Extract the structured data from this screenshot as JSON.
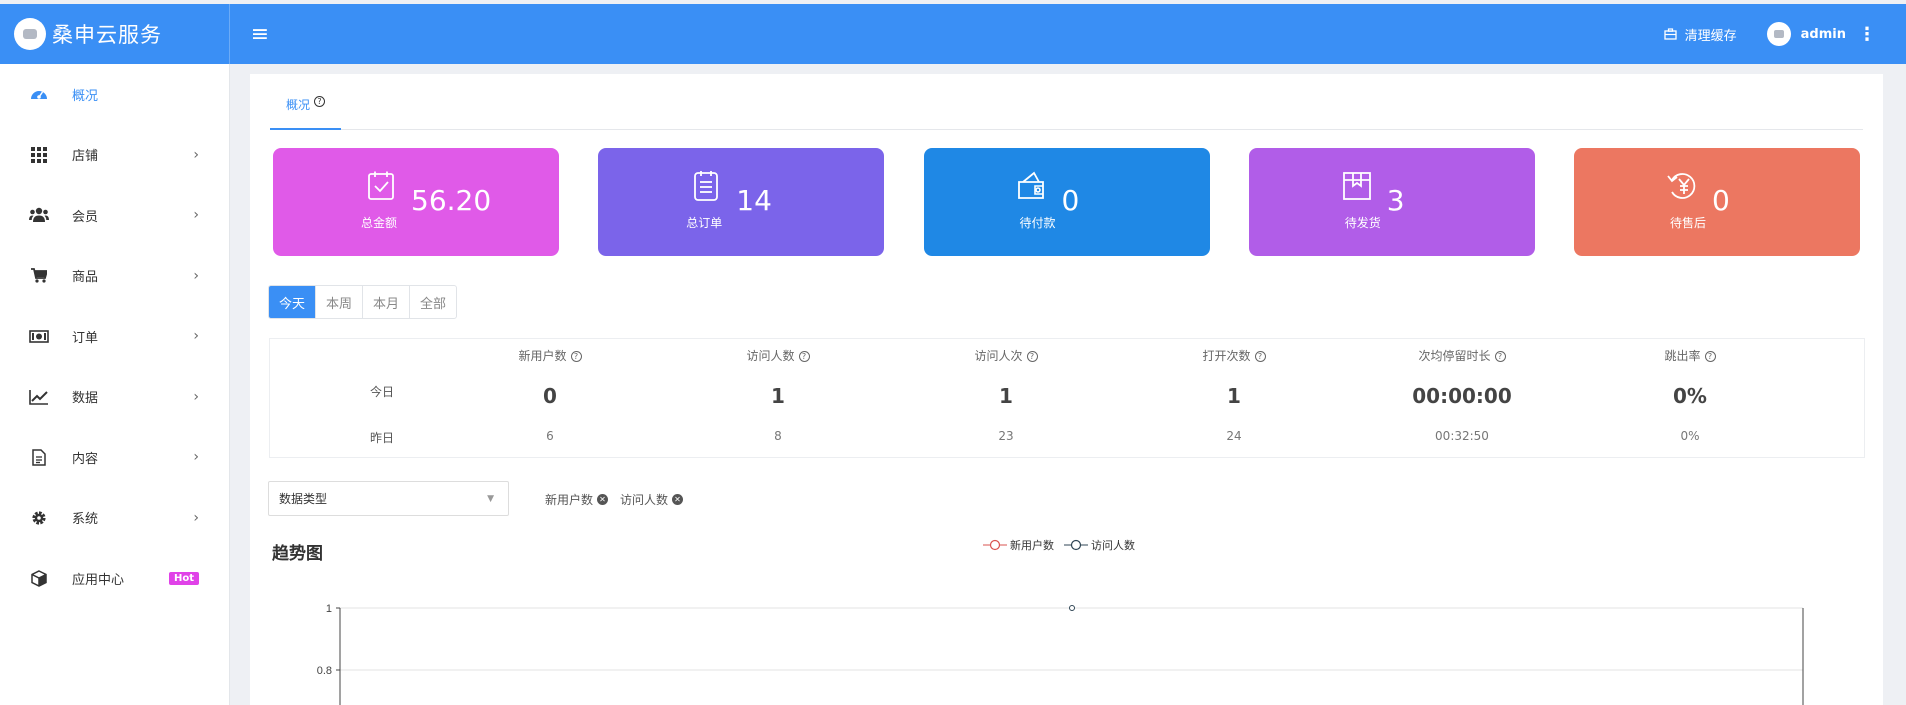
{
  "brand": {
    "name": "桑申云服务"
  },
  "header": {
    "clear_cache": "清理缓存",
    "user": "admin"
  },
  "sidebar": {
    "items": [
      {
        "label": "概况",
        "icon": "dashboard-icon"
      },
      {
        "label": "店铺",
        "icon": "grid-icon"
      },
      {
        "label": "会员",
        "icon": "users-icon"
      },
      {
        "label": "商品",
        "icon": "cart-icon"
      },
      {
        "label": "订单",
        "icon": "money-icon"
      },
      {
        "label": "数据",
        "icon": "line-chart-icon"
      },
      {
        "label": "内容",
        "icon": "document-icon"
      },
      {
        "label": "系统",
        "icon": "gear-icon"
      },
      {
        "label": "应用中心",
        "icon": "cube-icon",
        "badge": "Hot"
      }
    ]
  },
  "tabs": {
    "overview": "概况"
  },
  "cards": [
    {
      "value": "56.20",
      "label": "总金额",
      "color": "#e05ae8",
      "icon": "check-clipboard-icon"
    },
    {
      "value": "14",
      "label": "总订单",
      "color": "#7b64ea",
      "icon": "order-list-icon"
    },
    {
      "value": "0",
      "label": "待付款",
      "color": "#1f88e5",
      "icon": "wallet-icon"
    },
    {
      "value": "3",
      "label": "待发货",
      "color": "#b15de8",
      "icon": "package-icon"
    },
    {
      "value": "0",
      "label": "待售后",
      "color": "#ec7761",
      "icon": "refund-yen-icon"
    }
  ],
  "period": {
    "today": "今天",
    "week": "本周",
    "month": "本月",
    "all": "全部"
  },
  "stats": {
    "row_today": "今日",
    "row_yesterday": "昨日",
    "columns": [
      {
        "label": "新用户数",
        "today": "0",
        "yesterday": "6"
      },
      {
        "label": "访问人数",
        "today": "1",
        "yesterday": "8"
      },
      {
        "label": "访问人次",
        "today": "1",
        "yesterday": "23"
      },
      {
        "label": "打开次数",
        "today": "1",
        "yesterday": "24"
      },
      {
        "label": "次均停留时长",
        "today": "00:00:00",
        "yesterday": "00:32:50"
      },
      {
        "label": "跳出率",
        "today": "0%",
        "yesterday": "0%"
      }
    ]
  },
  "filter": {
    "select_label": "数据类型",
    "chips": [
      "新用户数",
      "访问人数"
    ]
  },
  "chart": {
    "title": "趋势图",
    "legend": [
      "新用户数",
      "访问人数"
    ],
    "series_colors": [
      "#d9534f",
      "#2f4554"
    ]
  },
  "chart_data": {
    "type": "line",
    "title": "趋势图",
    "series": [
      {
        "name": "新用户数",
        "color": "#d9534f"
      },
      {
        "name": "访问人数",
        "color": "#2f4554"
      }
    ],
    "y_ticks": [
      "1",
      "0.8"
    ],
    "ylim": [
      0,
      1
    ],
    "visible_points": [
      {
        "series": "访问人数",
        "y": 1
      }
    ]
  }
}
